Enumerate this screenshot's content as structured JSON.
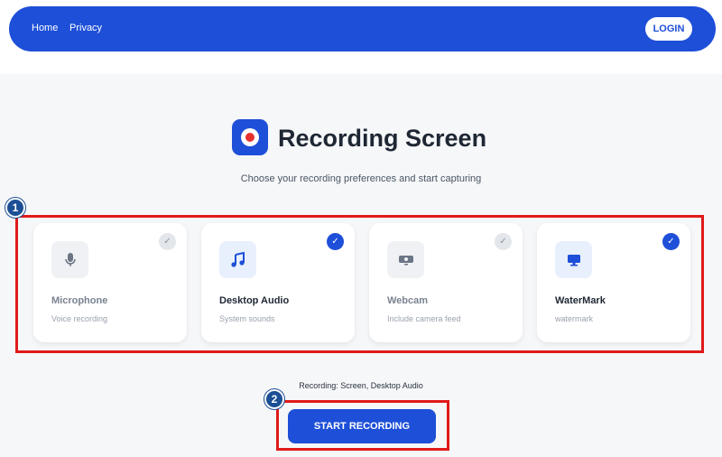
{
  "nav": {
    "home": "Home",
    "privacy": "Privacy",
    "login": "LOGIN"
  },
  "header": {
    "title": "Recording Screen",
    "subtitle": "Choose your recording preferences and start capturing"
  },
  "cards": [
    {
      "title": "Microphone",
      "subtitle": "Voice recording",
      "icon": "microphone-icon",
      "selected": false
    },
    {
      "title": "Desktop Audio",
      "subtitle": "System sounds",
      "icon": "music-note-icon",
      "selected": true
    },
    {
      "title": "Webcam",
      "subtitle": "Include camera feed",
      "icon": "webcam-icon",
      "selected": false
    },
    {
      "title": "WaterMark",
      "subtitle": "watermark",
      "icon": "monitor-icon",
      "selected": true
    }
  ],
  "status": "Recording: Screen, Desktop Audio",
  "start_button": "START RECORDING",
  "annotations": {
    "badge1": "1",
    "badge2": "2"
  },
  "colors": {
    "accent": "#1e4fd8",
    "highlight": "#e01a1a",
    "record": "#e53030"
  }
}
